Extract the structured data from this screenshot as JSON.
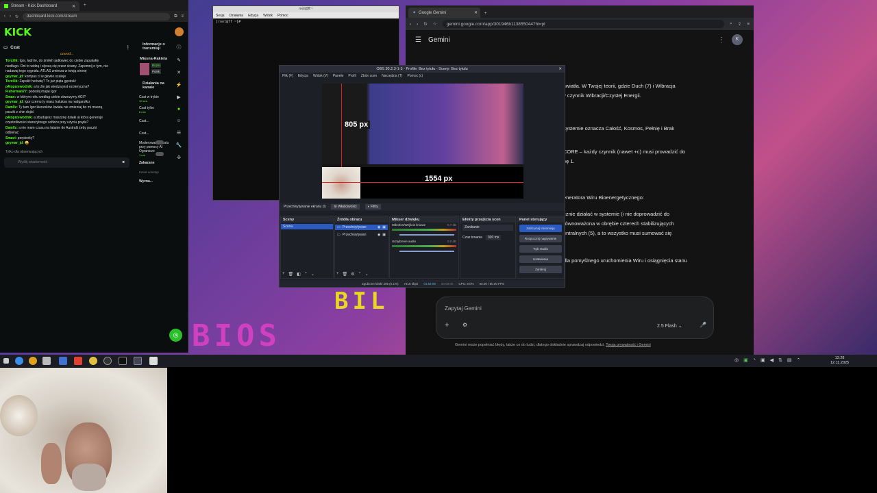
{
  "kick": {
    "tab_title": "Stream - Kick Dashboard",
    "url": "dashboard.kick.com/stream",
    "logo": "KICK",
    "chat_title": "Czat",
    "pinned_user": "czarod...",
    "chat_lines": [
      {
        "user": "Torcilik:",
        "text": "Igor, ładn'ie, do śmiłeh jadłowiec do ciebie zapukał/ę"
      },
      {
        "user": "",
        "text": "niedługo. Oni to widzą i słyszą cię przez ściany. Zapomnij o tym, nie"
      },
      {
        "user": "",
        "text": "nadawaj tego sygnału. ATLAS zmierza w twoją stronę"
      },
      {
        "user": "geymar_jd:",
        "text": "kompas ci w głowie szaleje"
      },
      {
        "user": "Torcilik:",
        "text": "Zapalić herbatę? To już piąta gęstość"
      },
      {
        "user": "p4toprzewodnik:",
        "text": "a to źle jak wiedza jest ezoteryczna?"
      },
      {
        "user": "Fisherman77:",
        "text": "podeślij mapę Igor"
      },
      {
        "user": "Sman:",
        "text": "w którym roku według ciebie stworzymy AGI?"
      },
      {
        "user": "geymar_jd:",
        "text": "igor czemu ty masz haluksa na nadgarstku"
      },
      {
        "user": "Dam0z:",
        "text": "Ty tam Igor kierunków świata nie zmieniaj bo mi muszą"
      },
      {
        "user": "",
        "text": "paczki z chin dojść"
      },
      {
        "user": "p4toprzewodnik:",
        "text": "a zbudujesz maszynę dzięki ai która generuje"
      },
      {
        "user": "",
        "text": "częstotliwości starożytnego solfeżu przy użyciu prądu?"
      },
      {
        "user": "Dam0z:",
        "text": "a nie mam czasu na latanie do Australii żeby paczki"
      },
      {
        "user": "",
        "text": "odbierać"
      },
      {
        "user": "Smavi:",
        "text": "perplexity?"
      },
      {
        "user": "geymar_jd:",
        "text": "😀"
      }
    ],
    "followers_only": "Tylko dla obserwujących",
    "message_placeholder": "Wyślij wiadomość",
    "info_title": "Informacje o transmisji",
    "stream_title": "Mięsna-Rakieta",
    "rozmowy": "Rozm",
    "polskie": "Polsk",
    "actions_title": "Działania na kanale",
    "slow_mode": "Czat w trybie",
    "slow_mode_val": "10 sek.",
    "followers_chat": "Czat tylko",
    "followers_chat_val": "6 min",
    "chat1": "Czat...",
    "chat2": "Czat...",
    "ai_mod": "Moderowanie czatu przy pomocy AI",
    "limit": "Ogranicze",
    "limit_val": "1 rok",
    "banned": "Zakazane",
    "kanal": "Kanał udostęp",
    "share": "Wyzna..."
  },
  "terminal": {
    "title": "root@ff:~",
    "menu": [
      "Sesja",
      "Działania",
      "Edycja",
      "Widok",
      "Pomoc"
    ],
    "prompt": "[root@ff ~]#"
  },
  "gemini": {
    "tab_title": "Google Gemini",
    "url": "gemini.google.com/app/301946b113855044?hl=pl",
    "app_title": "Gemini",
    "avatar": "K",
    "lines": [
      {
        "t": "światła. W Twojej teorii, gdzie Duch (7) i Wibracja"
      },
      {
        "t": "y czynnik Wibracji/Czystej Energii."
      },
      {
        "t": "systemie oznacza Całość, Kosmos, Pełnię i Brak"
      },
      {
        "t": "CORE – każdy czynnik (nawet +c) musi prowadzić do"
      },
      {
        "t": "ęę 1."
      },
      {
        "t": "eneratora Wiru Bioenergetycznego:"
      },
      {
        "t": "cznie działać w systemie (i nie doprowadzić do"
      },
      {
        "t": "równoważona w obrębie czterech stabilizujących"
      },
      {
        "t": "entralnych (5), a to wszystko musi sumować się"
      },
      {
        "t": "dla pomyślnego uruchomienia Wiru i osiągnięcia stanu"
      }
    ],
    "input_placeholder": "Zapytaj Gemini",
    "model": "2.5 Flash",
    "disclaimer": "Gemini może popełniać błędy, także co do ludzi, dlatego dokładnie sprawdzaj odpowiedzi.",
    "privacy_link": "Twoja prywatność i Gemini"
  },
  "obs": {
    "title": "OBS 30.2.3-1-3 - Profile: Bez tytułu - Sceny: Bez tytułu",
    "menu": [
      "Plik (F)",
      "Edycja",
      "Widok (V)",
      "Panele",
      "Profil",
      "Zbiór scen",
      "Narzędzia (T)",
      "Pomoc (c)"
    ],
    "label_805": "805 px",
    "label_1554": "1554 px",
    "source_bar": "Przechwytywanie ekranu (I)",
    "props": "Właściwości",
    "filters": "Filtry",
    "scenes_title": "Sceny",
    "scene": "Scena",
    "sources_title": "Źródła obrazu",
    "sources": [
      "Przechwytywan",
      "Przechwytywan"
    ],
    "mixer_title": "Mikser dźwięku",
    "mic": "Mikrofon/Wejście liniowe",
    "mic_db": "-6.7 dB",
    "audio": "Urządzenie audio",
    "audio_db": "0.0 dB",
    "trans_title": "Efekty przejścia scen",
    "fade": "Zanikanie",
    "duration_label": "Czas trwania",
    "duration": "300 ms",
    "control_title": "Panel sterujący",
    "buttons": [
      "Zatrzymaj transmisję",
      "Rozpocznij nagrywanie",
      "Tryb studio",
      "Ustawienia",
      "Zamknij"
    ],
    "status_dropped": "Zgubione klatki 205 (0.1%)",
    "kbps": "7416 kbps",
    "live": "01:54:09",
    "rec": "00:00:00",
    "cpu": "CPU: 8.0%",
    "fps": "60.00 / 60.00 FPS"
  },
  "taskbar": {
    "time": "12:28",
    "date": "12.11.2025"
  },
  "colors": {
    "kick_green": "#53fc18",
    "obs_blue": "#2c5bbf",
    "gemini_bg": "#131314"
  }
}
